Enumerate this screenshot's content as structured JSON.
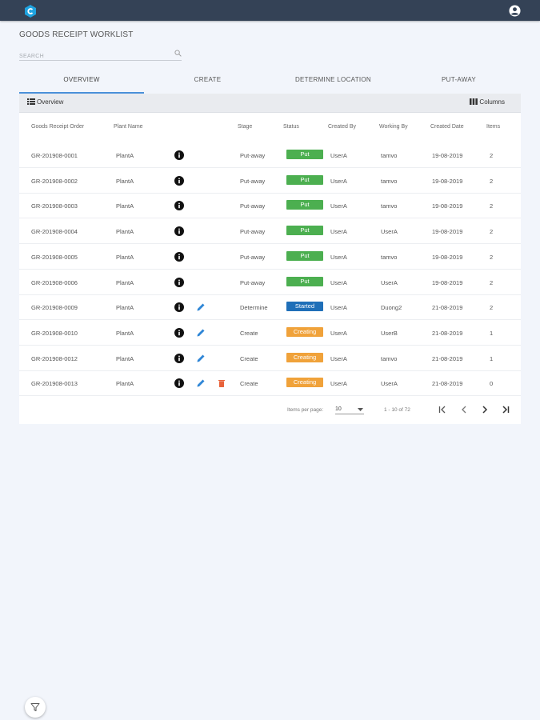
{
  "page": {
    "title": "GOODS RECEIPT WORKLIST",
    "search_placeholder": "SEARCH"
  },
  "tabs": [
    {
      "label": "OVERVIEW",
      "active": true
    },
    {
      "label": "CREATE",
      "active": false
    },
    {
      "label": "DETERMINE LOCATION",
      "active": false
    },
    {
      "label": "PUT-AWAY",
      "active": false
    }
  ],
  "toolbar": {
    "overview_label": "Overview",
    "columns_label": "Columns"
  },
  "table": {
    "headers": [
      "Goods Receipt Order",
      "Plant Name",
      "Stage",
      "Status",
      "Created By",
      "Working By",
      "Created Date",
      "Items"
    ],
    "rows": [
      {
        "order": "GR-201908-0001",
        "plant": "PlantA",
        "stage": "Put-away",
        "status": "Put",
        "status_kind": "put",
        "created_by": "UserA",
        "working_by": "tamvo",
        "date": "19-08-2019",
        "items": "2",
        "actions": [
          "info"
        ]
      },
      {
        "order": "GR-201908-0002",
        "plant": "PlantA",
        "stage": "Put-away",
        "status": "Put",
        "status_kind": "put",
        "created_by": "UserA",
        "working_by": "tamvo",
        "date": "19-08-2019",
        "items": "2",
        "actions": [
          "info"
        ]
      },
      {
        "order": "GR-201908-0003",
        "plant": "PlantA",
        "stage": "Put-away",
        "status": "Put",
        "status_kind": "put",
        "created_by": "UserA",
        "working_by": "tamvo",
        "date": "19-08-2019",
        "items": "2",
        "actions": [
          "info"
        ]
      },
      {
        "order": "GR-201908-0004",
        "plant": "PlantA",
        "stage": "Put-away",
        "status": "Put",
        "status_kind": "put",
        "created_by": "UserA",
        "working_by": "UserA",
        "date": "19-08-2019",
        "items": "2",
        "actions": [
          "info"
        ]
      },
      {
        "order": "GR-201908-0005",
        "plant": "PlantA",
        "stage": "Put-away",
        "status": "Put",
        "status_kind": "put",
        "created_by": "UserA",
        "working_by": "tamvo",
        "date": "19-08-2019",
        "items": "2",
        "actions": [
          "info"
        ]
      },
      {
        "order": "GR-201908-0006",
        "plant": "PlantA",
        "stage": "Put-away",
        "status": "Put",
        "status_kind": "put",
        "created_by": "UserA",
        "working_by": "UserA",
        "date": "19-08-2019",
        "items": "2",
        "actions": [
          "info"
        ]
      },
      {
        "order": "GR-201908-0009",
        "plant": "PlantA",
        "stage": "Determine",
        "status": "Started",
        "status_kind": "started",
        "created_by": "UserA",
        "working_by": "Duong2",
        "date": "21-08-2019",
        "items": "2",
        "actions": [
          "info",
          "edit"
        ]
      },
      {
        "order": "GR-201908-0010",
        "plant": "PlantA",
        "stage": "Create",
        "status": "Creating",
        "status_kind": "creating",
        "created_by": "UserA",
        "working_by": "UserB",
        "date": "21-08-2019",
        "items": "1",
        "actions": [
          "info",
          "edit"
        ]
      },
      {
        "order": "GR-201908-0012",
        "plant": "PlantA",
        "stage": "Create",
        "status": "Creating",
        "status_kind": "creating",
        "created_by": "UserA",
        "working_by": "tamvo",
        "date": "21-08-2019",
        "items": "1",
        "actions": [
          "info",
          "edit"
        ]
      },
      {
        "order": "GR-201908-0013",
        "plant": "PlantA",
        "stage": "Create",
        "status": "Creating",
        "status_kind": "creating",
        "created_by": "UserA",
        "working_by": "UserA",
        "date": "21-08-2019",
        "items": "0",
        "actions": [
          "info",
          "edit",
          "delete"
        ]
      }
    ]
  },
  "pagination": {
    "items_per_page_label": "Items per page:",
    "page_size": "10",
    "range_label": "1 - 10 of 72"
  },
  "colors": {
    "header_bg": "#344256",
    "accent": "#4a90d9",
    "put": "#4caf50",
    "started": "#1f6fb8",
    "creating": "#f0a23a",
    "delete": "#e8623a"
  }
}
